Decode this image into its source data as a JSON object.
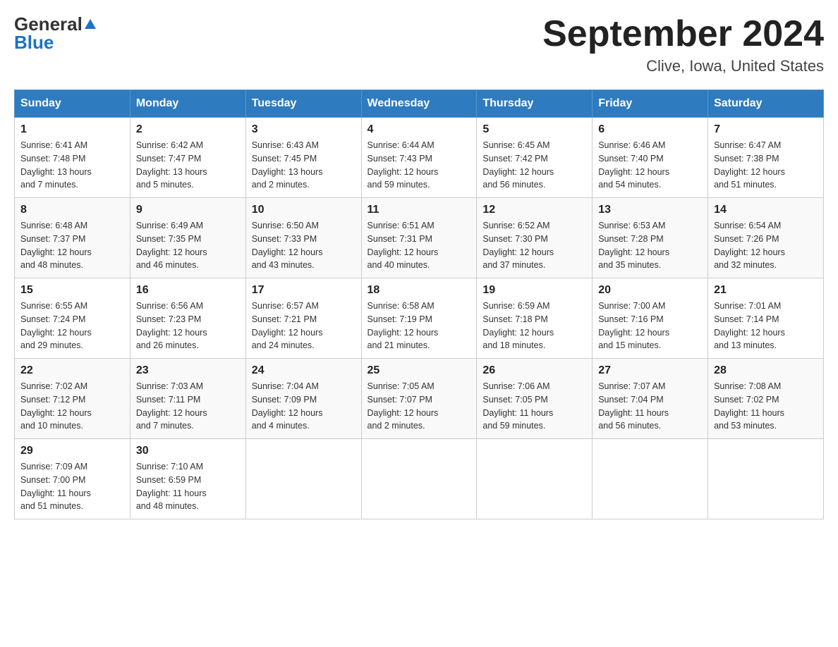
{
  "header": {
    "logo_general": "General",
    "logo_blue": "Blue",
    "month_title": "September 2024",
    "location": "Clive, Iowa, United States"
  },
  "days_of_week": [
    "Sunday",
    "Monday",
    "Tuesday",
    "Wednesday",
    "Thursday",
    "Friday",
    "Saturday"
  ],
  "weeks": [
    [
      {
        "day": "1",
        "info": "Sunrise: 6:41 AM\nSunset: 7:48 PM\nDaylight: 13 hours\nand 7 minutes."
      },
      {
        "day": "2",
        "info": "Sunrise: 6:42 AM\nSunset: 7:47 PM\nDaylight: 13 hours\nand 5 minutes."
      },
      {
        "day": "3",
        "info": "Sunrise: 6:43 AM\nSunset: 7:45 PM\nDaylight: 13 hours\nand 2 minutes."
      },
      {
        "day": "4",
        "info": "Sunrise: 6:44 AM\nSunset: 7:43 PM\nDaylight: 12 hours\nand 59 minutes."
      },
      {
        "day": "5",
        "info": "Sunrise: 6:45 AM\nSunset: 7:42 PM\nDaylight: 12 hours\nand 56 minutes."
      },
      {
        "day": "6",
        "info": "Sunrise: 6:46 AM\nSunset: 7:40 PM\nDaylight: 12 hours\nand 54 minutes."
      },
      {
        "day": "7",
        "info": "Sunrise: 6:47 AM\nSunset: 7:38 PM\nDaylight: 12 hours\nand 51 minutes."
      }
    ],
    [
      {
        "day": "8",
        "info": "Sunrise: 6:48 AM\nSunset: 7:37 PM\nDaylight: 12 hours\nand 48 minutes."
      },
      {
        "day": "9",
        "info": "Sunrise: 6:49 AM\nSunset: 7:35 PM\nDaylight: 12 hours\nand 46 minutes."
      },
      {
        "day": "10",
        "info": "Sunrise: 6:50 AM\nSunset: 7:33 PM\nDaylight: 12 hours\nand 43 minutes."
      },
      {
        "day": "11",
        "info": "Sunrise: 6:51 AM\nSunset: 7:31 PM\nDaylight: 12 hours\nand 40 minutes."
      },
      {
        "day": "12",
        "info": "Sunrise: 6:52 AM\nSunset: 7:30 PM\nDaylight: 12 hours\nand 37 minutes."
      },
      {
        "day": "13",
        "info": "Sunrise: 6:53 AM\nSunset: 7:28 PM\nDaylight: 12 hours\nand 35 minutes."
      },
      {
        "day": "14",
        "info": "Sunrise: 6:54 AM\nSunset: 7:26 PM\nDaylight: 12 hours\nand 32 minutes."
      }
    ],
    [
      {
        "day": "15",
        "info": "Sunrise: 6:55 AM\nSunset: 7:24 PM\nDaylight: 12 hours\nand 29 minutes."
      },
      {
        "day": "16",
        "info": "Sunrise: 6:56 AM\nSunset: 7:23 PM\nDaylight: 12 hours\nand 26 minutes."
      },
      {
        "day": "17",
        "info": "Sunrise: 6:57 AM\nSunset: 7:21 PM\nDaylight: 12 hours\nand 24 minutes."
      },
      {
        "day": "18",
        "info": "Sunrise: 6:58 AM\nSunset: 7:19 PM\nDaylight: 12 hours\nand 21 minutes."
      },
      {
        "day": "19",
        "info": "Sunrise: 6:59 AM\nSunset: 7:18 PM\nDaylight: 12 hours\nand 18 minutes."
      },
      {
        "day": "20",
        "info": "Sunrise: 7:00 AM\nSunset: 7:16 PM\nDaylight: 12 hours\nand 15 minutes."
      },
      {
        "day": "21",
        "info": "Sunrise: 7:01 AM\nSunset: 7:14 PM\nDaylight: 12 hours\nand 13 minutes."
      }
    ],
    [
      {
        "day": "22",
        "info": "Sunrise: 7:02 AM\nSunset: 7:12 PM\nDaylight: 12 hours\nand 10 minutes."
      },
      {
        "day": "23",
        "info": "Sunrise: 7:03 AM\nSunset: 7:11 PM\nDaylight: 12 hours\nand 7 minutes."
      },
      {
        "day": "24",
        "info": "Sunrise: 7:04 AM\nSunset: 7:09 PM\nDaylight: 12 hours\nand 4 minutes."
      },
      {
        "day": "25",
        "info": "Sunrise: 7:05 AM\nSunset: 7:07 PM\nDaylight: 12 hours\nand 2 minutes."
      },
      {
        "day": "26",
        "info": "Sunrise: 7:06 AM\nSunset: 7:05 PM\nDaylight: 11 hours\nand 59 minutes."
      },
      {
        "day": "27",
        "info": "Sunrise: 7:07 AM\nSunset: 7:04 PM\nDaylight: 11 hours\nand 56 minutes."
      },
      {
        "day": "28",
        "info": "Sunrise: 7:08 AM\nSunset: 7:02 PM\nDaylight: 11 hours\nand 53 minutes."
      }
    ],
    [
      {
        "day": "29",
        "info": "Sunrise: 7:09 AM\nSunset: 7:00 PM\nDaylight: 11 hours\nand 51 minutes."
      },
      {
        "day": "30",
        "info": "Sunrise: 7:10 AM\nSunset: 6:59 PM\nDaylight: 11 hours\nand 48 minutes."
      },
      {
        "day": "",
        "info": ""
      },
      {
        "day": "",
        "info": ""
      },
      {
        "day": "",
        "info": ""
      },
      {
        "day": "",
        "info": ""
      },
      {
        "day": "",
        "info": ""
      }
    ]
  ]
}
